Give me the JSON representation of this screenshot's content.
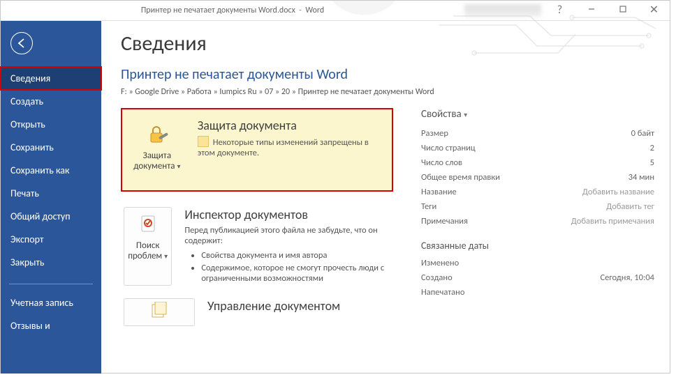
{
  "title": {
    "filename": "Принтер не печатает документы Word.docx",
    "appname": "Word"
  },
  "sidebar": {
    "info": "Сведения",
    "create": "Создать",
    "open": "Открыть",
    "save": "Сохранить",
    "saveas": "Сохранить как",
    "print": "Печать",
    "share": "Общий доступ",
    "export": "Экспорт",
    "close": "Закрыть",
    "account": "Учетная запись",
    "feedback": "Отзывы и"
  },
  "main": {
    "page_title": "Сведения",
    "doc_link": "Принтер не печатает документы Word",
    "breadcrumb": "F: » Google Drive » Работа » Iumpics Ru » 07 » 20 » Принтер не печатает документы Word",
    "protect": {
      "btn": "Защита документа",
      "heading": "Защита документа",
      "desc": "Некоторые типы изменений запрещены в этом документе."
    },
    "inspect": {
      "btn": "Поиск проблем",
      "heading": "Инспектор документов",
      "desc": "Перед публикацией этого файла не забудьте, что он содержит:",
      "bullets": [
        "Свойства документа и имя автора",
        "Содержимое, которое не смогут прочесть люди с ограниченными возможностями"
      ]
    },
    "manage": {
      "heading": "Управление документом"
    }
  },
  "props": {
    "heading": "Свойства",
    "size_l": "Размер",
    "size_v": "0 байт",
    "pages_l": "Число страниц",
    "pages_v": "2",
    "words_l": "Число слов",
    "words_v": "5",
    "edittime_l": "Общее время правки",
    "edittime_v": "34 мин",
    "title_l": "Название",
    "title_v": "Добавить название",
    "tags_l": "Теги",
    "tags_v": "Добавить тег",
    "comments_l": "Примечания",
    "comments_v": "Добавить примечания",
    "dates_heading": "Связанные даты",
    "modified_l": "Изменено",
    "modified_v": "",
    "created_l": "Создано",
    "created_v": "Сегодня, 10:04",
    "printed_l": "Напечатано",
    "printed_v": ""
  }
}
